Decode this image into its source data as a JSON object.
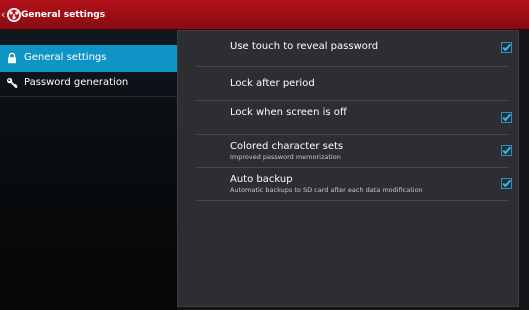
{
  "action_bar": {
    "title": "General settings",
    "accent": "#b5121b"
  },
  "sidebar": {
    "items": [
      {
        "label": "General settings",
        "icon": "lock-icon",
        "selected": true
      },
      {
        "label": "Password generation",
        "icon": "key-icon",
        "selected": false
      }
    ],
    "selected_color": "#0f94c6"
  },
  "preferences": [
    {
      "title": "Use touch to reveal password",
      "summary": "",
      "checked": true
    },
    {
      "title": "Lock after period",
      "summary": "",
      "checked": null
    },
    {
      "title": "Lock when screen is off",
      "summary": "",
      "checked": true
    },
    {
      "title": "Colored character sets",
      "summary": "Improved password memorization",
      "checked": true
    },
    {
      "title": "Auto backup",
      "summary": "Automatic backups to SD card after each data modification",
      "checked": true
    }
  ]
}
